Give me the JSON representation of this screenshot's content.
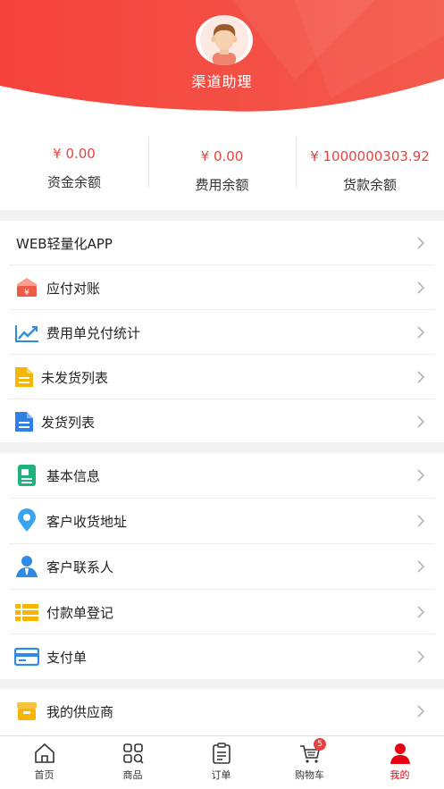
{
  "header": {
    "username": "渠道助理",
    "accent": "#f5433c"
  },
  "balances": [
    {
      "amount": "¥ 0.00",
      "label": "资金余额"
    },
    {
      "amount": "¥ 0.00",
      "label": "费用余额"
    },
    {
      "amount": "¥ 1000000303.92",
      "label": "货款余额"
    }
  ],
  "section1": {
    "items": [
      {
        "label": "WEB轻量化APP",
        "icon": ""
      },
      {
        "label": "应付对账",
        "icon": "yen-envelope-icon"
      },
      {
        "label": "费用单兑付统计",
        "icon": "trend-chart-icon"
      },
      {
        "label": "未发货列表",
        "icon": "yellow-document-icon"
      },
      {
        "label": "发货列表",
        "icon": "blue-document-icon"
      }
    ]
  },
  "section2": {
    "items": [
      {
        "label": "基本信息",
        "icon": "info-card-icon"
      },
      {
        "label": "客户收货地址",
        "icon": "location-pin-icon"
      },
      {
        "label": "客户联系人",
        "icon": "contact-person-icon"
      },
      {
        "label": "付款单登记",
        "icon": "list-icon"
      },
      {
        "label": "支付单",
        "icon": "credit-card-icon"
      }
    ]
  },
  "section3": {
    "items": [
      {
        "label": "我的供应商",
        "icon": "supplier-box-icon"
      }
    ]
  },
  "tabbar": {
    "tabs": [
      {
        "label": "首页",
        "icon": "home-icon"
      },
      {
        "label": "商品",
        "icon": "grid-search-icon"
      },
      {
        "label": "订单",
        "icon": "clipboard-icon"
      },
      {
        "label": "购物车",
        "icon": "cart-icon",
        "badge": "5"
      },
      {
        "label": "我的",
        "icon": "user-icon"
      }
    ],
    "active_color": "#e60012"
  }
}
